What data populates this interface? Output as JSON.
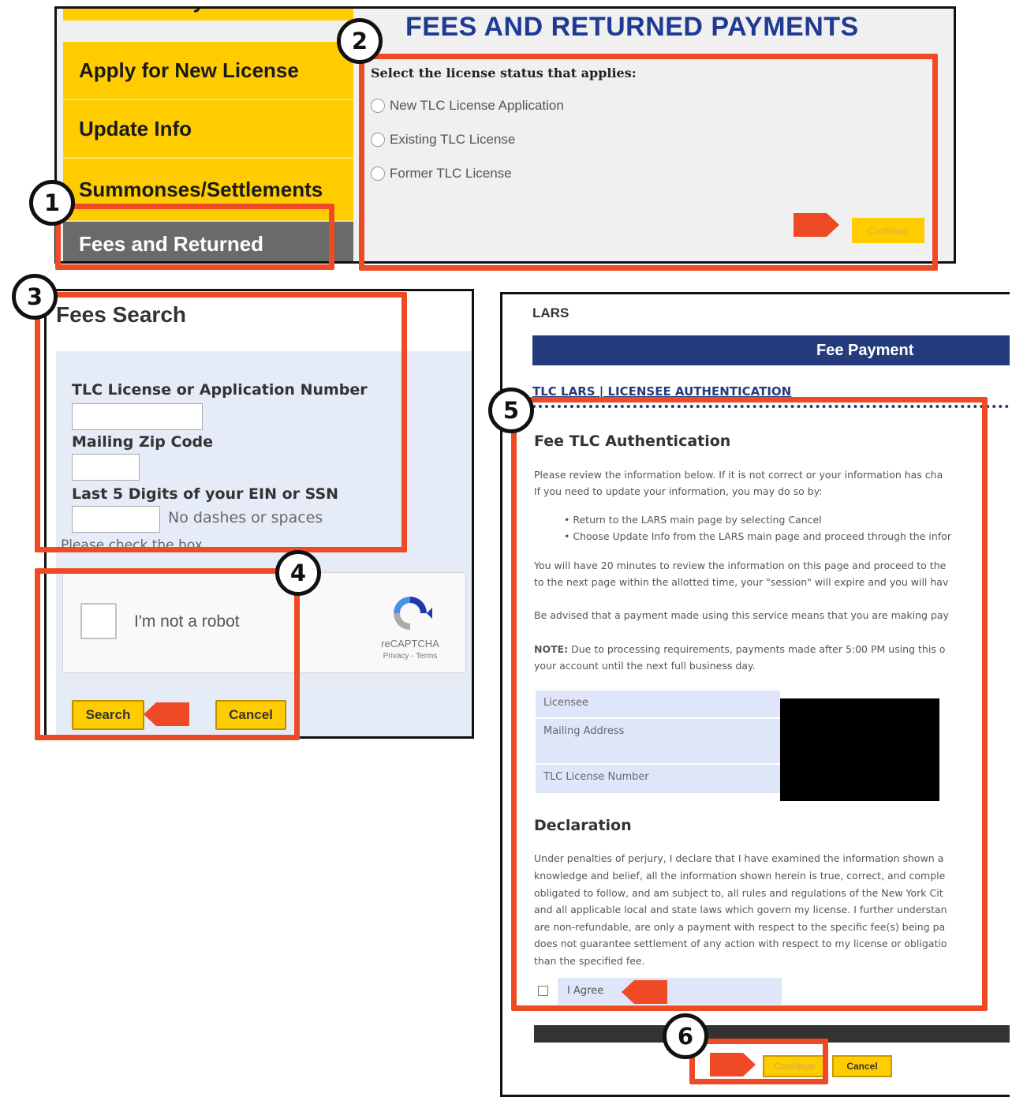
{
  "panel1": {
    "menu": {
      "items": [
        "Renewal Payment",
        "Apply for New License",
        "Update Info",
        "Summonses/Settlements",
        "Fees and Returned"
      ]
    },
    "title": "FEES AND RETURNED PAYMENTS",
    "status_question": "Select the license status that applies:",
    "radio_options": [
      "New TLC License Application",
      "Existing TLC License",
      "Former TLC License"
    ],
    "continue_label": "Continue"
  },
  "panel3": {
    "title": "Fees Search",
    "license_label": "TLC License or Application Number",
    "zip_label": "Mailing Zip Code",
    "ein_label": "Last 5 Digits of your EIN or SSN",
    "ein_hint": "No dashes or spaces",
    "check_note": "Please check the box",
    "captcha": {
      "text": "I'm not a robot",
      "brand": "reCAPTCHA",
      "links": "Privacy - Terms"
    },
    "search_label": "Search",
    "cancel_label": "Cancel"
  },
  "panel5": {
    "lars": "LARS",
    "bar_title": "Fee Payment",
    "auth_link": "TLC LARS | LICENSEE AUTHENTICATION",
    "section_title": "Fee TLC Authentication",
    "intro": [
      "Please review the information below. If it is not correct or your information has cha",
      "If you need to update your information, you may do so by:"
    ],
    "bullets": [
      "Return to the LARS main page by selecting Cancel",
      "Choose Update Info from the LARS main page and proceed through the infor"
    ],
    "timer_text": [
      "You will have 20 minutes to review the information on this page and proceed to the",
      "to the next page within the allotted time, your \"session\" will expire and you will hav"
    ],
    "advised_text": "Be advised that a payment made using this service means that you are making pay",
    "note_label": "NOTE:",
    "note_text": [
      " Due to processing requirements, payments made after 5:00 PM using this o",
      "your account until the next full business day."
    ],
    "fields": [
      "Licensee",
      "Mailing Address",
      "TLC License Number"
    ],
    "declaration_title": "Declaration",
    "declaration_text": [
      "Under penalties of perjury, I declare that I have examined the information shown a",
      "knowledge and belief, all the information shown herein is true, correct, and comple",
      "obligated to follow, and am subject to, all rules and regulations of the New York Cit",
      "and all applicable local and state laws which govern my license. I further understan",
      "are non-refundable, are only a payment with respect to the specific fee(s) being pa",
      "does not guarantee settlement of any action with respect to my license or obligatio",
      "than the specified fee."
    ],
    "agree_label": "I Agree",
    "continue_label": "Continue",
    "cancel_label": "Cancel"
  },
  "steps": [
    "1",
    "2",
    "3",
    "4",
    "5",
    "6"
  ],
  "colors": {
    "highlight": "#ee4a25",
    "menu_yellow": "#ffcc00",
    "title_blue": "#1f3a93",
    "bar_blue": "#243b7d"
  }
}
